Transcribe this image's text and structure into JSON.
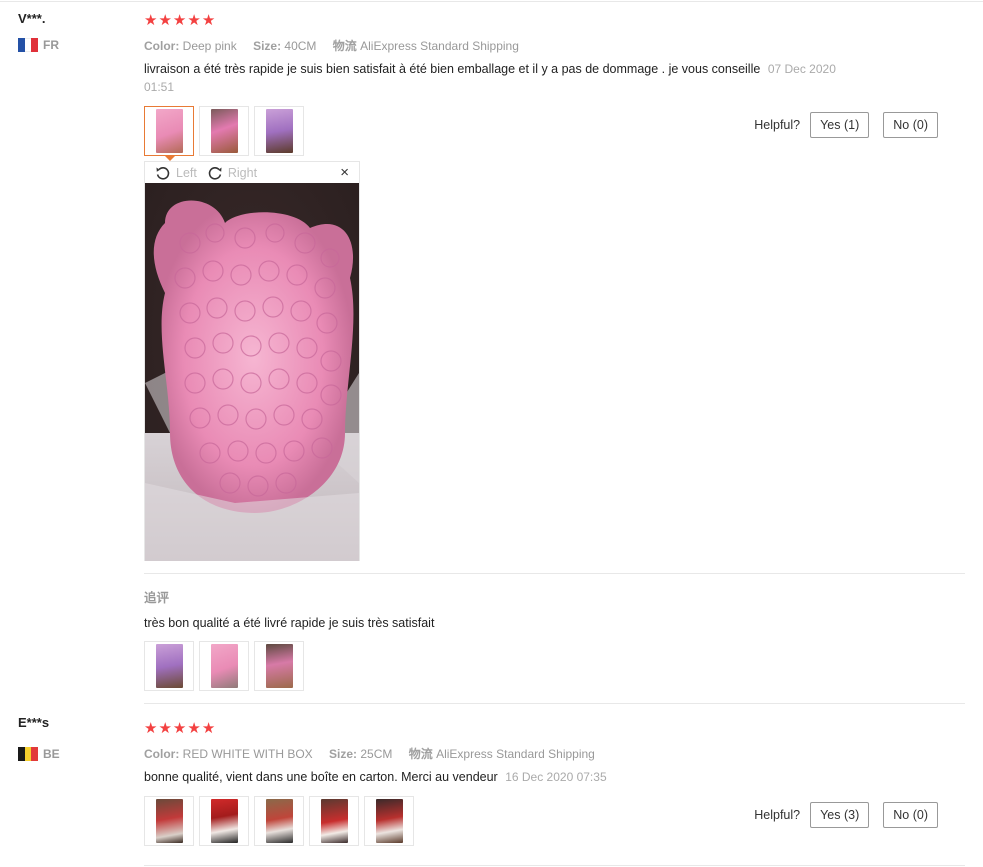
{
  "reviews": [
    {
      "user": {
        "name": "V***.",
        "country": "FR",
        "flag_colors": [
          "#2451a6",
          "#ffffff",
          "#e0313a"
        ]
      },
      "rating": 5,
      "meta": {
        "color_key": "Color:",
        "color_val": "Deep pink",
        "size_key": "Size:",
        "size_val": "40CM",
        "ship_key": "物流",
        "ship_val": "AliExpress Standard Shipping"
      },
      "content": "livraison a été très rapide je suis bien satisfait à été bien emballage et il y a pas de dommage . je vous conseille",
      "date": "07 Dec 2020 01:51",
      "helpful": {
        "label": "Helpful?",
        "yes": "Yes (1)",
        "no": "No (0)"
      },
      "viewer": {
        "left": "Left",
        "right": "Right",
        "close": "×"
      },
      "append": {
        "title": "追评",
        "content": "très bon qualité a été livré rapide je suis très satisfait"
      }
    },
    {
      "user": {
        "name": "E***s",
        "country": "BE",
        "flag_colors": [
          "#1a1a1a",
          "#f6d02e",
          "#e23a3a"
        ]
      },
      "rating": 5,
      "meta": {
        "color_key": "Color:",
        "color_val": "RED WHITE WITH BOX",
        "size_key": "Size:",
        "size_val": "25CM",
        "ship_key": "物流",
        "ship_val": "AliExpress Standard Shipping"
      },
      "content": "bonne qualité, vient dans une boîte en carton. Merci au vendeur",
      "date": "16 Dec 2020 07:35",
      "helpful": {
        "label": "Helpful?",
        "yes": "Yes (3)",
        "no": "No (0)"
      }
    }
  ],
  "colors": {
    "star": "#f34141",
    "active_thumb": "#e87a35",
    "rose_pink": "#e98bb5"
  }
}
